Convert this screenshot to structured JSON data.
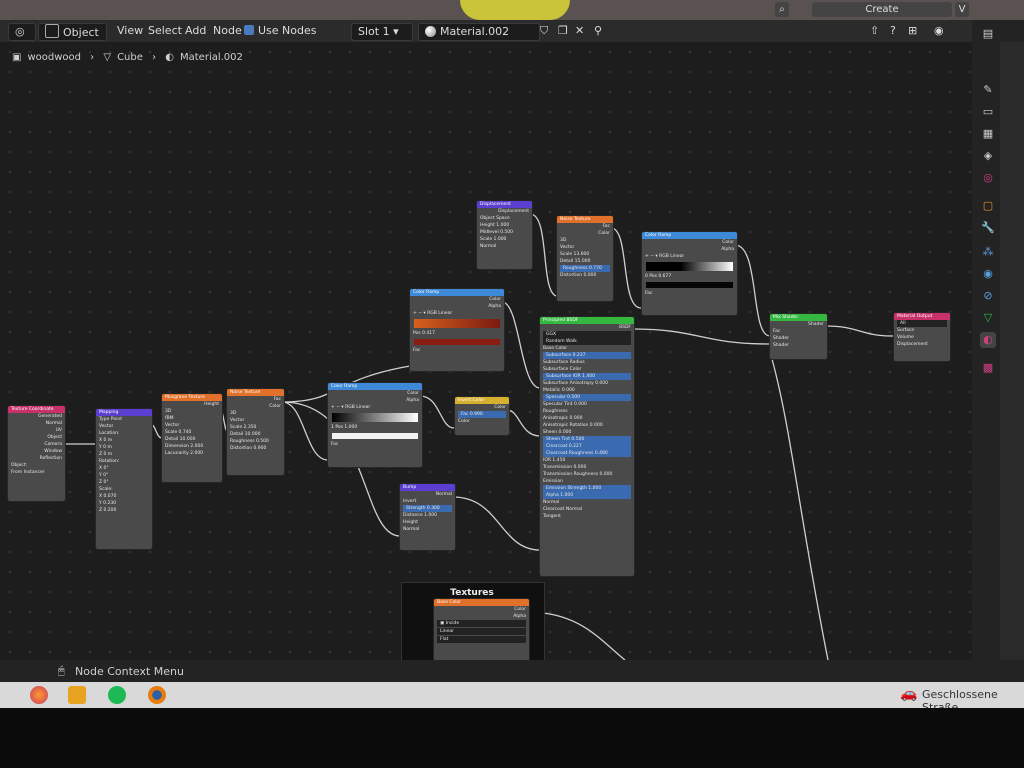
{
  "top": {
    "create_label": "Create"
  },
  "header": {
    "mode": "Object",
    "menus": [
      "View",
      "Select",
      "Add",
      "Node"
    ],
    "use_nodes_label": "Use Nodes",
    "slot": "Slot 1",
    "material": "Material.002"
  },
  "breadcrumb": [
    "woodwood",
    "Cube",
    "Material.002"
  ],
  "status": {
    "context_menu": "Node Context Menu",
    "notification": "Geschlossene Straße"
  },
  "frame": {
    "title": "Textures"
  },
  "nodes": {
    "tex_coord": {
      "title": "Texture Coordinate",
      "outputs": [
        "Generated",
        "Normal",
        "UV",
        "Object",
        "Camera",
        "Window",
        "Reflection"
      ],
      "object_label": "Object:",
      "from_instancer": "From Instancer"
    },
    "mapping": {
      "title": "Mapping",
      "type": "Point",
      "rows": [
        "Vector",
        "Location:",
        "X 0 m",
        "Y 0 m",
        "Z 0 m",
        "Rotation:",
        "X 0°",
        "Y 0°",
        "Z 0°",
        "Scale:",
        "X 0.070",
        "Y 0.230",
        "Z 0.200"
      ]
    },
    "musgrave": {
      "title": "Musgrave Texture",
      "rows": [
        "Height",
        "3D",
        "fBM",
        "Vector",
        "Scale 0.740",
        "Detail 10.000",
        "Dimension 2.000",
        "Lacunarity 2.000"
      ]
    },
    "noise1": {
      "title": "Noise Texture",
      "rows": [
        "Fac",
        "Color",
        "3D",
        "Vector",
        "Scale 2.350",
        "Detail 10.000",
        "Roughness 0.500",
        "Distortion 0.900"
      ]
    },
    "color_ramp1": {
      "title": "Color Ramp",
      "rows": [
        "Color",
        "Alpha",
        "RGB",
        "Linear",
        "1",
        "Pos 1.000",
        "Fac"
      ]
    },
    "invert": {
      "title": "Invert Color",
      "rows": [
        "Color",
        "Fac 0.990",
        "Color"
      ]
    },
    "bump": {
      "title": "Bump",
      "rows": [
        "Normal",
        "Invert",
        "Strength 0.300",
        "Distance 1.000",
        "Height",
        "Normal"
      ]
    },
    "displacement": {
      "title": "Displacement",
      "rows": [
        "Displacement",
        "Object Space",
        "Height 1.000",
        "Midlevel 0.500",
        "Scale 1.000",
        "Normal"
      ]
    },
    "noise2": {
      "title": "Noise Texture",
      "rows": [
        "Fac",
        "Color",
        "3D",
        "Vector",
        "Scale 13.600",
        "Detail 15.000",
        "Roughness 0.770",
        "Distortion 0.000"
      ]
    },
    "color_ramp2": {
      "title": "Color Ramp",
      "rows": [
        "Color",
        "Alpha",
        "RGB",
        "Linear",
        "Pos 0.417",
        "Fac"
      ]
    },
    "color_ramp3": {
      "title": "Color Ramp",
      "rows": [
        "Color",
        "Alpha",
        "RGB",
        "Linear",
        "0",
        "Pos 0.677",
        "Fac"
      ]
    },
    "principled": {
      "title": "Principled BSDF",
      "rows": [
        "BSDF",
        "GGX",
        "Random Walk",
        "Base Color",
        "Subsurface 0.237",
        "Subsurface Radius",
        "Subsurface Color",
        "Subsurface IOR 1.400",
        "Subsurface Anisotropy 0.000",
        "Metallic 0.000",
        "Specular 0.500",
        "Specular Tint 0.000",
        "Roughness",
        "Anisotropic 0.000",
        "Anisotropic Rotation 0.000",
        "Sheen 0.000",
        "Sheen Tint 0.500",
        "Clearcoat 0.227",
        "Clearcoat Roughness 0.480",
        "IOR 1.450",
        "Transmission 0.000",
        "Transmission Roughness 0.000",
        "Emission",
        "Emission Strength 1.000",
        "Alpha 1.000",
        "Normal",
        "Clearcoat Normal",
        "Tangent"
      ]
    },
    "mix_shader": {
      "title": "Mix Shader",
      "rows": [
        "Shader",
        "Fac",
        "Shader",
        "Shader"
      ]
    },
    "material_output": {
      "title": "Material Output",
      "rows": [
        "All",
        "Surface",
        "Volume",
        "Displacement"
      ]
    },
    "base_color": {
      "title": "Base Color",
      "rows": [
        "Color",
        "Alpha",
        "Inside",
        "Linear",
        "Flat"
      ]
    }
  },
  "colors": {
    "input_header": "#c8316a",
    "vector_header": "#5a3fd0",
    "texture_header": "#e0702a",
    "converter_header": "#3e8ad8",
    "shader_header": "#35b840",
    "output_header": "#c8316a"
  }
}
